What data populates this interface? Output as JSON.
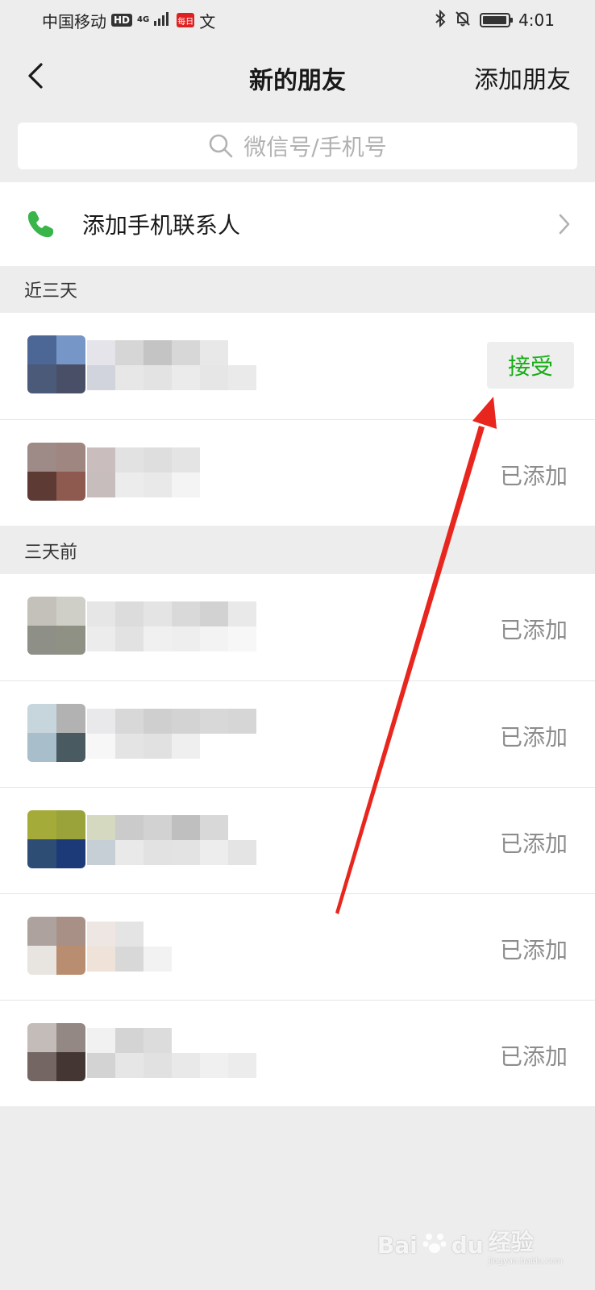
{
  "status_bar": {
    "carrier": "中国移动",
    "hd": "HD",
    "network": "4G",
    "app_badge": "每日",
    "extra_icon": "文",
    "time": "4:01"
  },
  "nav": {
    "back_icon": "chevron-left-icon",
    "title": "新的朋友",
    "action": "添加朋友"
  },
  "search": {
    "placeholder": "微信号/手机号"
  },
  "phone_contacts": {
    "label": "添加手机联系人"
  },
  "sections": [
    {
      "header": "近三天",
      "rows": [
        {
          "status": "接受",
          "type": "accept"
        },
        {
          "status": "已添加",
          "type": "added"
        }
      ]
    },
    {
      "header": "三天前",
      "rows": [
        {
          "status": "已添加",
          "type": "added"
        },
        {
          "status": "已添加",
          "type": "added"
        },
        {
          "status": "已添加",
          "type": "added"
        },
        {
          "status": "已添加",
          "type": "added"
        },
        {
          "status": "已添加",
          "type": "added"
        }
      ]
    }
  ],
  "colors": {
    "accent_green": "#1aad19",
    "annotation_arrow": "#e8261e"
  },
  "watermark": {
    "brand": "Bai",
    "paw": "du",
    "product": "经验",
    "url": "jingyan.baidu.com"
  }
}
